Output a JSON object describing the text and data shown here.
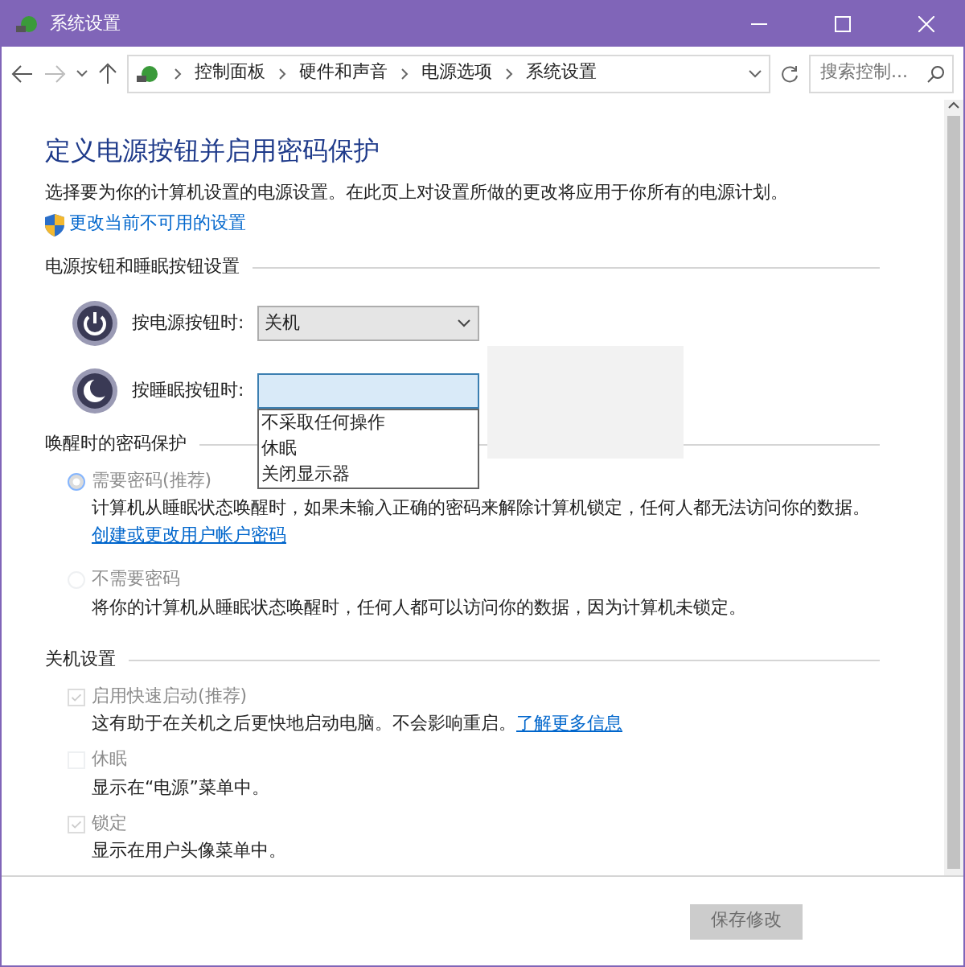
{
  "window": {
    "title": "系统设置"
  },
  "address_bar": {
    "breadcrumbs": [
      "控制面板",
      "硬件和声音",
      "电源选项",
      "系统设置"
    ],
    "search": {
      "placeholder": "搜索控制..."
    }
  },
  "heading": "定义电源按钮并启用密码保护",
  "description": "选择要为你的计算机设置的电源设置。在此页上对设置所做的更改将应用于你所有的电源计划。",
  "admin_link": "更改当前不可用的设置",
  "power_section": {
    "title": "电源按钮和睡眠按钮设置",
    "rows": [
      {
        "kind": "power",
        "label": "按电源按钮时:",
        "value": "关机",
        "expanded": false
      },
      {
        "kind": "sleep",
        "label": "按睡眠按钮时:",
        "expanded": true,
        "options": [
          {
            "label": "不采取任何操作",
            "selected": false
          },
          {
            "label": "休眠",
            "selected": false
          },
          {
            "label": "关闭显示器",
            "selected": false
          }
        ]
      }
    ]
  },
  "password_section": {
    "title": "唤醒时的密码保护",
    "options": [
      {
        "label": "需要密码(推荐)",
        "selected": true,
        "disabled": true,
        "description": "计算机从睡眠状态唤醒时，如果未输入正确的密码来解除计算机锁定，任何人都无法访问你的数据。",
        "link": "创建或更改用户帐户密码"
      },
      {
        "label": "不需要密码",
        "selected": false,
        "disabled": true,
        "description": "将你的计算机从睡眠状态唤醒时，任何人都可以访问你的数据，因为计算机未锁定。"
      }
    ]
  },
  "shutdown_section": {
    "title": "关机设置",
    "items": [
      {
        "label": "启用快速启动(推荐)",
        "checked": true,
        "disabled": true,
        "description": "这有助于在关机之后更快地启动电脑。不会影响重启。",
        "link": "了解更多信息"
      },
      {
        "label": "休眠",
        "checked": false,
        "disabled": true,
        "description": "显示在“电源”菜单中。"
      },
      {
        "label": "锁定",
        "checked": true,
        "disabled": true,
        "description": "显示在用户头像菜单中。"
      }
    ]
  },
  "buttons": [
    {
      "label": "保存修改",
      "disabled": true
    }
  ]
}
